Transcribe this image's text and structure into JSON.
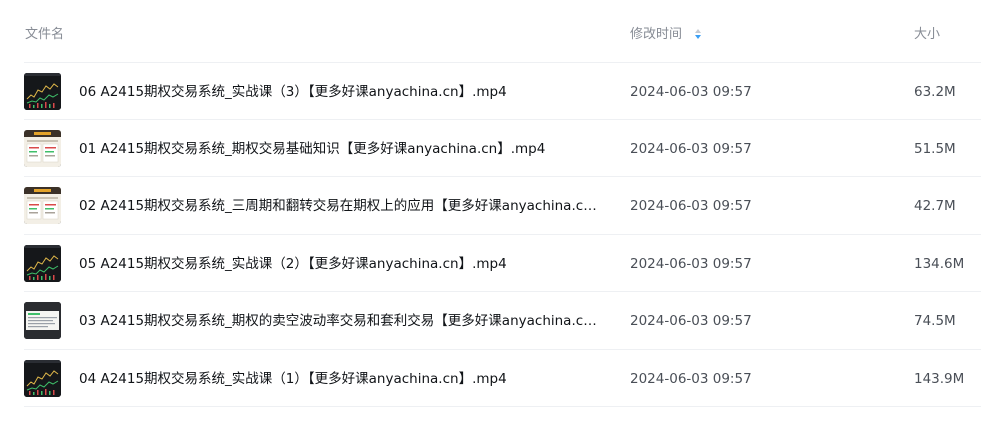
{
  "header": {
    "col_name": "文件名",
    "col_time": "修改时间",
    "col_size": "大小",
    "sort_icon": "sort-ascending-icon",
    "accent_color": "#3a9ff5"
  },
  "files": [
    {
      "name": "06 A2415期权交易系统_实战课（3）【更多好课anyachina.cn】.mp4",
      "time": "2024-06-03 09:57",
      "size": "63.2M",
      "thumb": "dark-chart-thumbnail"
    },
    {
      "name": "01 A2415期权交易系统_期权交易基础知识【更多好课anyachina.cn】.mp4",
      "time": "2024-06-03 09:57",
      "size": "51.5M",
      "thumb": "slide-thumbnail"
    },
    {
      "name": "02 A2415期权交易系统_三周期和翻转交易在期权上的应用【更多好课anyachina.cn...",
      "time": "2024-06-03 09:57",
      "size": "42.7M",
      "thumb": "slide-thumbnail"
    },
    {
      "name": "05 A2415期权交易系统_实战课（2）【更多好课anyachina.cn】.mp4",
      "time": "2024-06-03 09:57",
      "size": "134.6M",
      "thumb": "dark-chart-thumbnail"
    },
    {
      "name": "03 A2415期权交易系统_期权的卖空波动率交易和套利交易【更多好课anyachina.cn...",
      "time": "2024-06-03 09:57",
      "size": "74.5M",
      "thumb": "document-thumbnail"
    },
    {
      "name": "04 A2415期权交易系统_实战课（1）【更多好课anyachina.cn】.mp4",
      "time": "2024-06-03 09:57",
      "size": "143.9M",
      "thumb": "dark-chart-thumbnail"
    }
  ]
}
